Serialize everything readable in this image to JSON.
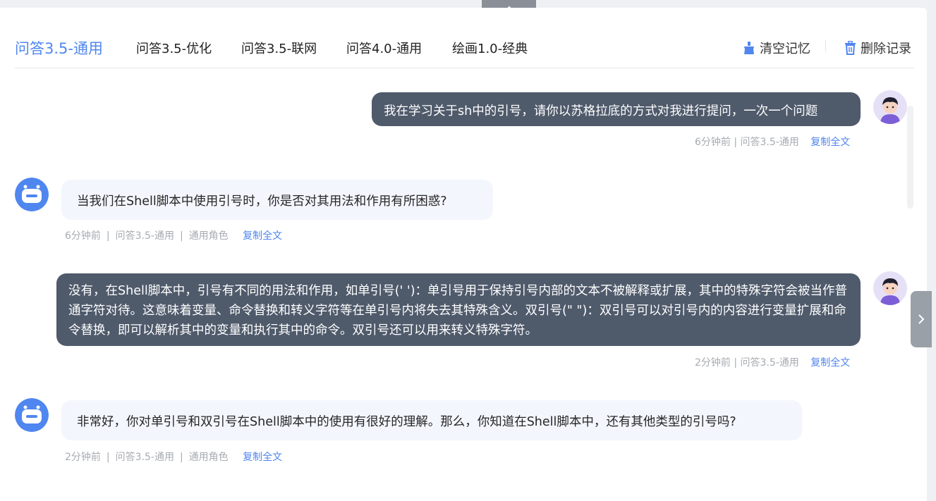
{
  "tabs": [
    {
      "label": "问答3.5-通用",
      "active": true
    },
    {
      "label": "问答3.5-优化",
      "active": false
    },
    {
      "label": "问答3.5-联网",
      "active": false
    },
    {
      "label": "问答4.0-通用",
      "active": false
    },
    {
      "label": "绘画1.0-经典",
      "active": false
    }
  ],
  "actions": {
    "clear_memory": "清空记忆",
    "delete_records": "删除记录"
  },
  "messages": [
    {
      "role": "user",
      "text": "我在学习关于sh中的引号，请你以苏格拉底的方式对我进行提问，一次一个问题",
      "meta": "6分钟前 | 问答3.5-通用",
      "copy": "复制全文"
    },
    {
      "role": "assistant",
      "text": "当我们在Shell脚本中使用引号时，你是否对其用法和作用有所困惑?",
      "time": "6分钟前",
      "model": "问答3.5-通用",
      "persona": "通用角色",
      "copy": "复制全文"
    },
    {
      "role": "user",
      "text": "没有，在Shell脚本中，引号有不同的用法和作用，如单引号(' ')：单引号用于保持引号内部的文本不被解释或扩展，其中的特殊字符会被当作普通字符对待。这意味着变量、命令替换和转义字符等在单引号内将失去其特殊含义。双引号(\" \")：双引号可以对引号内的内容进行变量扩展和命令替换，即可以解析其中的变量和执行其中的命令。双引号还可以用来转义特殊字符。",
      "meta": "2分钟前 | 问答3.5-通用",
      "copy": "复制全文"
    },
    {
      "role": "assistant",
      "text": "非常好，你对单引号和双引号在Shell脚本中的使用有很好的理解。那么，你知道在Shell脚本中，还有其他类型的引号吗?",
      "time": "2分钟前",
      "model": "问答3.5-通用",
      "persona": "通用角色",
      "copy": "复制全文"
    }
  ],
  "colors": {
    "accent": "#4f86f0",
    "user_bubble": "#4f5a6b",
    "bot_bubble": "#f3f6fd",
    "meta_text": "#a7abb1"
  },
  "icons": {
    "collapse": "chevron-up-icon",
    "clear": "broom-icon",
    "delete": "trash-icon",
    "expand_side": "chevron-right-icon",
    "user_avatar": "user-avatar-icon",
    "bot_avatar": "robot-avatar-icon"
  }
}
